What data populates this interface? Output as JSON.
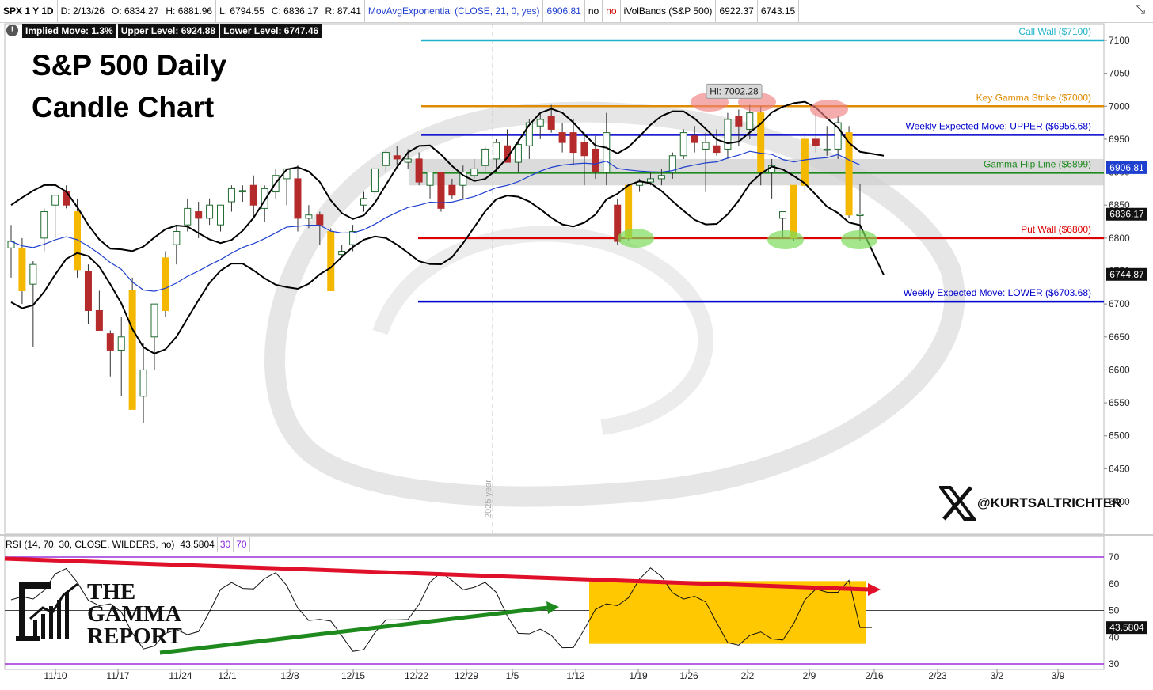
{
  "header": {
    "symbol": "SPX 1 Y 1D",
    "date": "D: 2/13/26",
    "open": "O: 6834.27",
    "high": "H: 6881.96",
    "low": "L: 6794.55",
    "close": "C: 6836.17",
    "range": "R: 87.41",
    "ma_study": "MovAvgExponential (CLOSE, 21, 0, yes)",
    "ma_value": "6906.81",
    "no1": "no",
    "no2": "no",
    "band_study": "iVolBands (S&P 500)",
    "band_upper": "6922.37",
    "band_lower": "6743.15"
  },
  "info_bar": {
    "implied_move": "Implied Move: 1.3%",
    "upper_level": "Upper Level: 6924.88",
    "lower_level": "Lower Level: 6747.46"
  },
  "title": {
    "line1": "S&P 500 Daily",
    "line2": "Candle Chart"
  },
  "rsi_header": {
    "study": "RSI (14, 70, 30, CLOSE, WILDERS, no)",
    "value": "43.5804",
    "lower": "30",
    "upper": "70"
  },
  "branding": {
    "logo_line1": "THE",
    "logo_line2": "GAMMA",
    "logo_line3": "REPORT",
    "handle": "@KURTSALTRICHTER"
  },
  "colors": {
    "up_candle": "#1e6b2e",
    "down_candle": "#b52a2a",
    "gap_candle": "#f5b800",
    "call_wall": "#20b2c8",
    "key_gamma": "#e08a00",
    "weekly_move": "#0000cc",
    "gamma_flip": "#1e8a1e",
    "put_wall": "#dd0000",
    "ema": "#1f3fcf",
    "rsi_trend_down": "#e0102a",
    "rsi_trend_up": "#1e8a1e",
    "rsi_box": "#ffc800"
  },
  "chart_data": {
    "type": "candlestick",
    "y_ticks": [
      6400,
      6450,
      6500,
      6550,
      6600,
      6650,
      6700,
      6750,
      6800,
      6850,
      6900,
      6950,
      7000,
      7050,
      7100
    ],
    "ylim": [
      6350,
      7130
    ],
    "x_tick_labels": [
      "11/10",
      "11/17",
      "11/24",
      "12/1",
      "12/8",
      "12/15",
      "12/22",
      "12/29",
      "1/5",
      "1/12",
      "1/19",
      "1/26",
      "2/2",
      "2/9",
      "2/16",
      "2/23",
      "3/2",
      "3/9"
    ],
    "year_marker": "2025 year",
    "levels": [
      {
        "name": "Call Wall ($7100)",
        "value": 7100,
        "color": "#20b2c8"
      },
      {
        "name": "Key Gamma Strike ($7000)",
        "value": 7000,
        "color": "#e08a00"
      },
      {
        "name": "Weekly Expected Move: UPPER  ($6956.68)",
        "value": 6956.68,
        "color": "#0000cc"
      },
      {
        "name": "Gamma Flip Line ($6899)",
        "value": 6899,
        "color": "#1e8a1e"
      },
      {
        "name": "Put Wall ($6800)",
        "value": 6800,
        "color": "#dd0000"
      },
      {
        "name": "Weekly Expected Move: LOWER ($6703.68)",
        "value": 6703.68,
        "color": "#0000cc"
      }
    ],
    "price_tags": [
      {
        "value": 6906.81,
        "label": "6906.81",
        "bg": "#1f3fcf"
      },
      {
        "value": 6836.17,
        "label": "6836.17",
        "bg": "#111111"
      },
      {
        "value": 6744.87,
        "label": "6744.87",
        "bg": "#111111"
      }
    ],
    "hi_label": {
      "text": "Hi: 7002.28",
      "value": 7002.28
    },
    "candles": [
      {
        "o": 6785,
        "h": 6820,
        "l": 6740,
        "c": 6795
      },
      {
        "o": 6785,
        "h": 6800,
        "l": 6700,
        "c": 6720
      },
      {
        "o": 6730,
        "h": 6765,
        "l": 6635,
        "c": 6760
      },
      {
        "o": 6800,
        "h": 6845,
        "l": 6780,
        "c": 6840
      },
      {
        "o": 6850,
        "h": 6865,
        "l": 6800,
        "c": 6865
      },
      {
        "o": 6870,
        "h": 6880,
        "l": 6845,
        "c": 6850
      },
      {
        "o": 6840,
        "h": 6860,
        "l": 6740,
        "c": 6752
      },
      {
        "o": 6750,
        "h": 6760,
        "l": 6670,
        "c": 6690
      },
      {
        "o": 6690,
        "h": 6720,
        "l": 6660,
        "c": 6660
      },
      {
        "o": 6655,
        "h": 6660,
        "l": 6590,
        "c": 6630
      },
      {
        "o": 6630,
        "h": 6680,
        "l": 6560,
        "c": 6650
      },
      {
        "o": 6720,
        "h": 6740,
        "l": 6540,
        "c": 6540
      },
      {
        "o": 6560,
        "h": 6640,
        "l": 6520,
        "c": 6600
      },
      {
        "o": 6650,
        "h": 6700,
        "l": 6600,
        "c": 6700
      },
      {
        "o": 6690,
        "h": 6780,
        "l": 6680,
        "c": 6770
      },
      {
        "o": 6790,
        "h": 6820,
        "l": 6760,
        "c": 6810
      },
      {
        "o": 6820,
        "h": 6860,
        "l": 6810,
        "c": 6845
      },
      {
        "o": 6840,
        "h": 6855,
        "l": 6800,
        "c": 6830
      },
      {
        "o": 6830,
        "h": 6860,
        "l": 6820,
        "c": 6850
      },
      {
        "o": 6820,
        "h": 6850,
        "l": 6810,
        "c": 6850
      },
      {
        "o": 6855,
        "h": 6880,
        "l": 6840,
        "c": 6875
      },
      {
        "o": 6870,
        "h": 6880,
        "l": 6855,
        "c": 6872
      },
      {
        "o": 6880,
        "h": 6895,
        "l": 6830,
        "c": 6850
      },
      {
        "o": 6845,
        "h": 6880,
        "l": 6825,
        "c": 6875
      },
      {
        "o": 6870,
        "h": 6905,
        "l": 6860,
        "c": 6895
      },
      {
        "o": 6890,
        "h": 6905,
        "l": 6850,
        "c": 6905
      },
      {
        "o": 6890,
        "h": 6910,
        "l": 6810,
        "c": 6830
      },
      {
        "o": 6830,
        "h": 6850,
        "l": 6815,
        "c": 6835
      },
      {
        "o": 6835,
        "h": 6840,
        "l": 6790,
        "c": 6820
      },
      {
        "o": 6810,
        "h": 6815,
        "l": 6720,
        "c": 6720
      },
      {
        "o": 6775,
        "h": 6790,
        "l": 6770,
        "c": 6780
      },
      {
        "o": 6790,
        "h": 6820,
        "l": 6780,
        "c": 6810
      },
      {
        "o": 6850,
        "h": 6870,
        "l": 6840,
        "c": 6860
      },
      {
        "o": 6870,
        "h": 6900,
        "l": 6860,
        "c": 6905
      },
      {
        "o": 6910,
        "h": 6935,
        "l": 6900,
        "c": 6930
      },
      {
        "o": 6925,
        "h": 6940,
        "l": 6910,
        "c": 6920
      },
      {
        "o": 6915,
        "h": 6935,
        "l": 6905,
        "c": 6920
      },
      {
        "o": 6920,
        "h": 6930,
        "l": 6880,
        "c": 6885
      },
      {
        "o": 6880,
        "h": 6900,
        "l": 6860,
        "c": 6900
      },
      {
        "o": 6900,
        "h": 6900,
        "l": 6840,
        "c": 6845
      },
      {
        "o": 6880,
        "h": 6890,
        "l": 6860,
        "c": 6865
      },
      {
        "o": 6880,
        "h": 6910,
        "l": 6860,
        "c": 6900
      },
      {
        "o": 6895,
        "h": 6920,
        "l": 6890,
        "c": 6905
      },
      {
        "o": 6910,
        "h": 6940,
        "l": 6900,
        "c": 6935
      },
      {
        "o": 6920,
        "h": 6950,
        "l": 6900,
        "c": 6945
      },
      {
        "o": 6940,
        "h": 6965,
        "l": 6930,
        "c": 6915
      },
      {
        "o": 6915,
        "h": 6950,
        "l": 6900,
        "c": 6942
      },
      {
        "o": 6940,
        "h": 6980,
        "l": 6920,
        "c": 6975
      },
      {
        "o": 6970,
        "h": 6990,
        "l": 6950,
        "c": 6980
      },
      {
        "o": 6985,
        "h": 7002,
        "l": 6960,
        "c": 6965
      },
      {
        "o": 6960,
        "h": 6975,
        "l": 6930,
        "c": 6945
      },
      {
        "o": 6960,
        "h": 6980,
        "l": 6910,
        "c": 6930
      },
      {
        "o": 6945,
        "h": 6960,
        "l": 6880,
        "c": 6925
      },
      {
        "o": 6935,
        "h": 6955,
        "l": 6890,
        "c": 6900
      },
      {
        "o": 6900,
        "h": 6990,
        "l": 6880,
        "c": 6960
      },
      {
        "o": 6850,
        "h": 6860,
        "l": 6790,
        "c": 6795
      },
      {
        "o": 6800,
        "h": 6880,
        "l": 6795,
        "c": 6880
      },
      {
        "o": 6880,
        "h": 6890,
        "l": 6870,
        "c": 6885
      },
      {
        "o": 6885,
        "h": 6900,
        "l": 6880,
        "c": 6890
      },
      {
        "o": 6890,
        "h": 6905,
        "l": 6880,
        "c": 6895
      },
      {
        "o": 6900,
        "h": 6930,
        "l": 6890,
        "c": 6925
      },
      {
        "o": 6925,
        "h": 6965,
        "l": 6920,
        "c": 6960
      },
      {
        "o": 6955,
        "h": 6970,
        "l": 6930,
        "c": 6945
      },
      {
        "o": 6935,
        "h": 6960,
        "l": 6870,
        "c": 6945
      },
      {
        "o": 6940,
        "h": 6965,
        "l": 6925,
        "c": 6930
      },
      {
        "o": 6935,
        "h": 6990,
        "l": 6920,
        "c": 6980
      },
      {
        "o": 6985,
        "h": 6995,
        "l": 6940,
        "c": 6970
      },
      {
        "o": 6965,
        "h": 7002,
        "l": 6950,
        "c": 6990
      },
      {
        "o": 6990,
        "h": 7000,
        "l": 6880,
        "c": 6900
      },
      {
        "o": 6900,
        "h": 6920,
        "l": 6860,
        "c": 6910
      },
      {
        "o": 6830,
        "h": 6840,
        "l": 6800,
        "c": 6840
      },
      {
        "o": 6800,
        "h": 6880,
        "l": 6795,
        "c": 6880
      },
      {
        "o": 6880,
        "h": 6960,
        "l": 6870,
        "c": 6950
      },
      {
        "o": 6950,
        "h": 6990,
        "l": 6930,
        "c": 6940
      },
      {
        "o": 6935,
        "h": 6970,
        "l": 6925,
        "c": 6935
      },
      {
        "o": 6935,
        "h": 6985,
        "l": 6920,
        "c": 6975
      },
      {
        "o": 6960,
        "h": 6970,
        "l": 6830,
        "c": 6835
      },
      {
        "o": 6834,
        "h": 6882,
        "l": 6795,
        "c": 6836
      }
    ],
    "rsi": {
      "ylim": [
        30,
        70
      ],
      "ticks": [
        30,
        40,
        50,
        60,
        70
      ],
      "last": 43.58
    }
  }
}
